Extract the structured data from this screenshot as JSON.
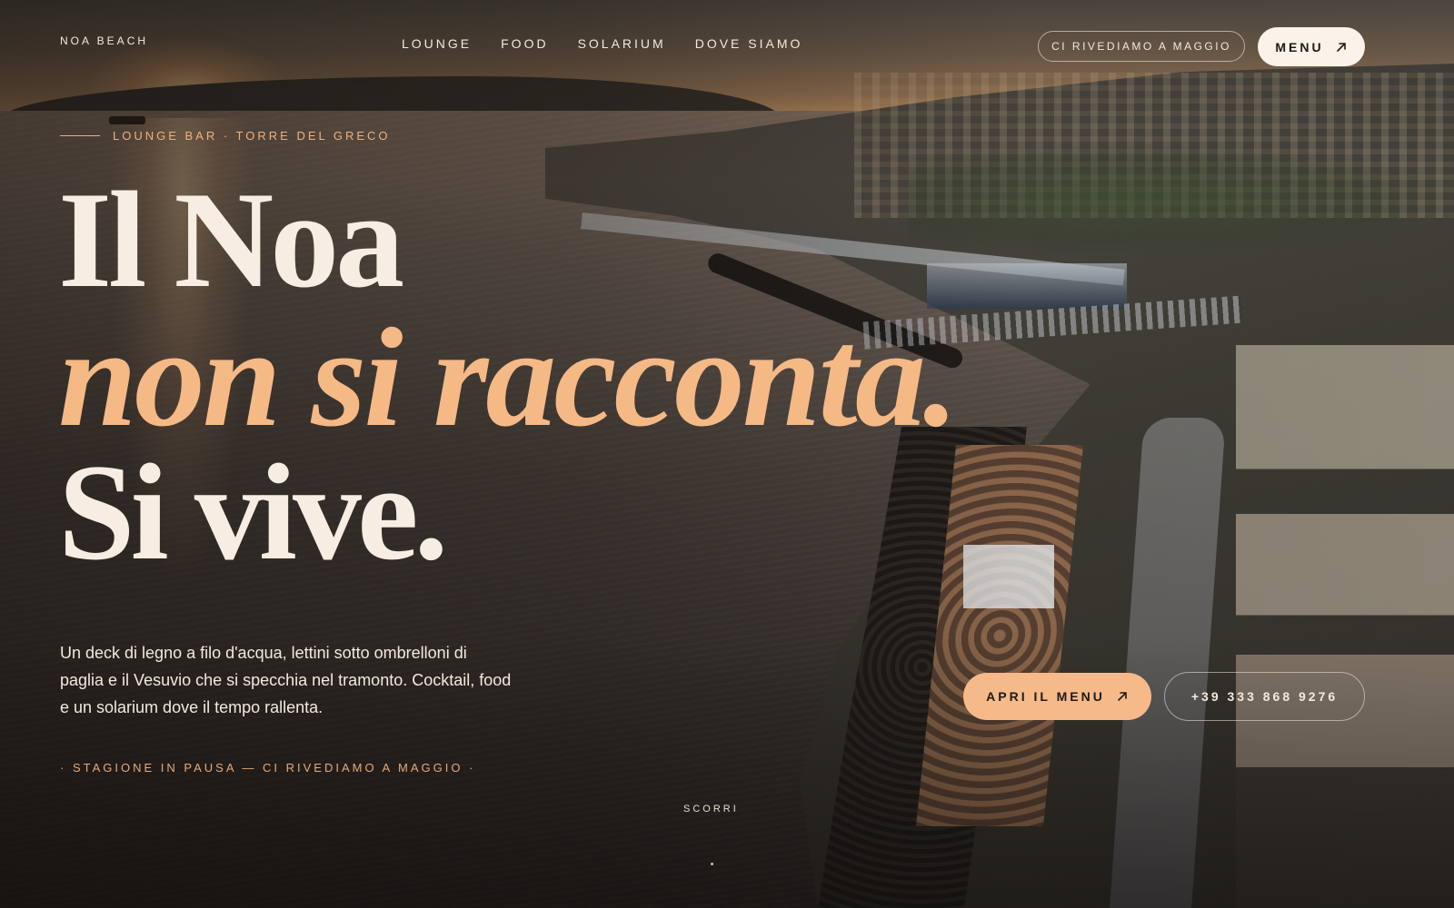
{
  "brand": {
    "name": "NOA BEACH"
  },
  "nav": {
    "items": [
      {
        "label": "LOUNGE"
      },
      {
        "label": "FOOD"
      },
      {
        "label": "SOLARIUM"
      },
      {
        "label": "DOVE SIAMO"
      }
    ]
  },
  "header": {
    "status_pill": "CI RIVEDIAMO A MAGGIO",
    "menu_button": "MENU",
    "menu_icon": "arrow-up-right-icon"
  },
  "hero": {
    "eyebrow": "LOUNGE BAR · TORRE DEL GRECO",
    "headline_line1": "Il Noa",
    "headline_line2": "non si racconta.",
    "headline_line3": "Si vive.",
    "description": "Un deck di legno a filo d'acqua, lettini sotto ombrelloni di paglia e il Vesuvio che si specchia nel tramonto. Cocktail, food e un solarium dove il tempo rallenta.",
    "season_note": "· STAGIONE IN PAUSA — CI RIVEDIAMO A MAGGIO ·",
    "cta_primary": "APRI IL MENU",
    "cta_primary_icon": "arrow-up-right-icon",
    "cta_phone": "+39 333 868 9276",
    "scroll_label": "SCORRI"
  },
  "colors": {
    "accent_peach": "#f6b98a",
    "cream": "#f7ede2",
    "eyebrow_orange": "#f0b07e"
  }
}
